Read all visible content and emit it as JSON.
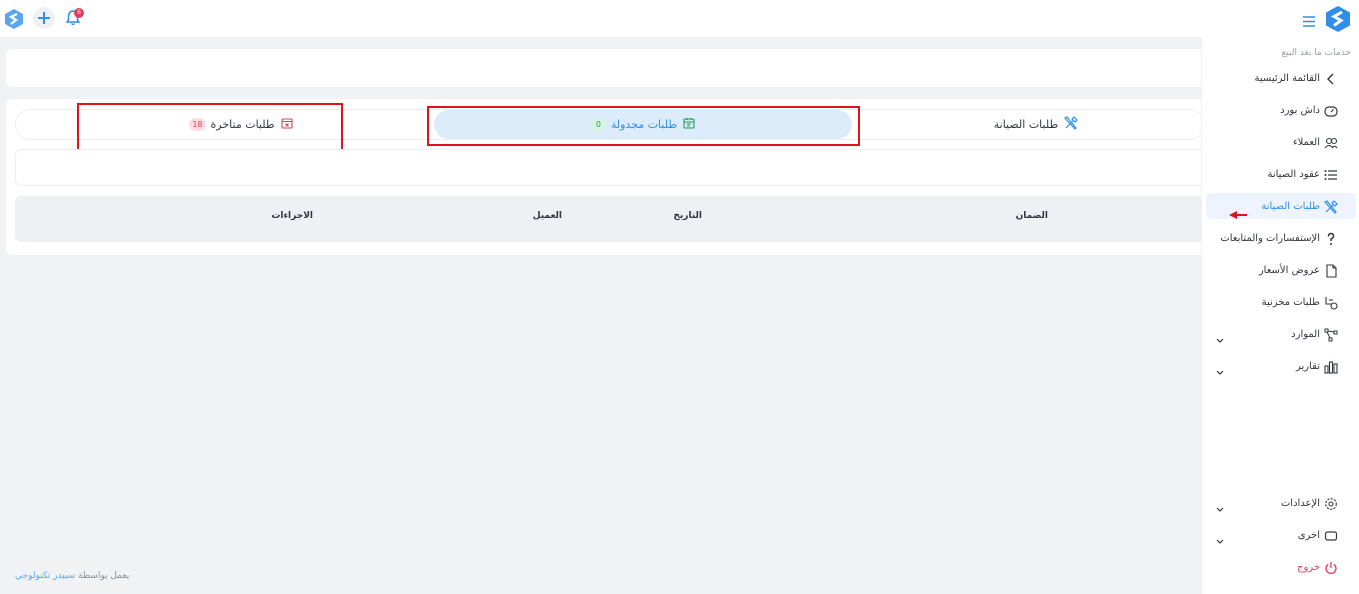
{
  "topbar": {
    "notification_count": "6"
  },
  "sidebar": {
    "heading": "خدمات ما بعد البيع",
    "items": [
      {
        "label": "القائمة الرئيسية",
        "icon": "chevron-left-icon"
      },
      {
        "label": "داش بورد",
        "icon": "speedometer-icon"
      },
      {
        "label": "العملاء",
        "icon": "users-icon"
      },
      {
        "label": "عقود الصيانة",
        "icon": "list-icon"
      },
      {
        "label": "طلبات الصيانة",
        "icon": "tools-icon",
        "active": true
      },
      {
        "label": "الإستفسارات والمتابعات",
        "icon": "question-icon"
      },
      {
        "label": "عروض الأسعار",
        "icon": "document-icon"
      },
      {
        "label": "طلبات مخزنية",
        "icon": "stock-icon"
      },
      {
        "label": "الموارد",
        "icon": "share-icon"
      },
      {
        "label": "تقارير",
        "icon": "bar-chart-icon"
      },
      {
        "label": "الإعدادات",
        "icon": "gear-icon"
      },
      {
        "label": "اخرى",
        "icon": "rectangle-icon"
      },
      {
        "label": "خروج",
        "icon": "power-icon"
      }
    ]
  },
  "tabs": [
    {
      "label": "طلبات الصيانة",
      "icon": "tools-icon"
    },
    {
      "label": "طلبات مجدولة",
      "badge": "0",
      "icon": "calendar-icon",
      "active": true
    },
    {
      "label": "طلبات متاخرة",
      "badge": "18",
      "icon": "calendar-x-icon"
    }
  ],
  "table": {
    "headers": [
      "الضمان",
      "التاريخ",
      "العميل",
      "الاجراءات"
    ]
  },
  "footer": {
    "prefix": "يعمل بواسطة",
    "brand": "سبيدر تكنولوجي"
  },
  "colors": {
    "accent": "#2f8ee8",
    "danger": "#e23c5a",
    "highlight": "#e0131c"
  }
}
